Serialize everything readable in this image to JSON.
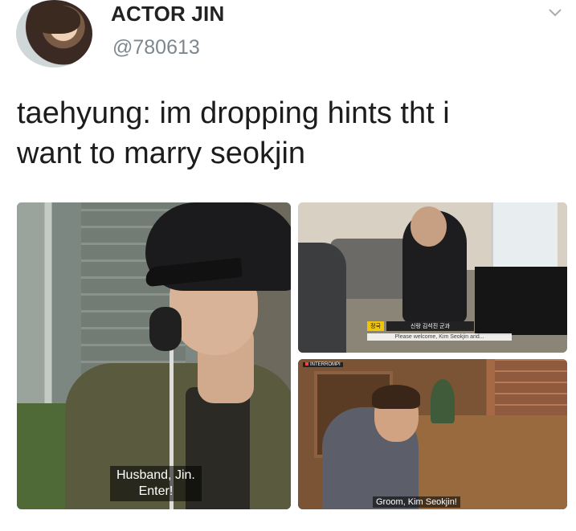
{
  "user": {
    "display_name": "ACTOR JIN",
    "handle": "@780613"
  },
  "tweet": {
    "line1": "taehyung: im dropping hints tht i",
    "line2": "want to marry seokjin"
  },
  "images": {
    "left_subtitle": "Husband, Jin.\nEnter!",
    "top_right_tag": "정국",
    "top_right_caption_kr": "신랑 김석진 군과",
    "top_right_caption_en": "Please welcome, Kim Seokjin and...",
    "bottom_right_tag": "INTERROMPI",
    "bottom_right_subtitle": "Groom, Kim Seokjin!"
  },
  "colors": {
    "name": "#222222",
    "handle": "#7d8790",
    "text": "#1c1c1c",
    "accent_tag": "#f3c400"
  },
  "icons": {
    "menu": "chevron-down-icon"
  }
}
